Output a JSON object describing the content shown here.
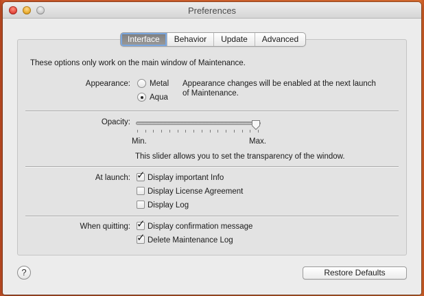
{
  "window": {
    "title": "Preferences"
  },
  "tabs": [
    {
      "label": "Interface",
      "selected": true
    },
    {
      "label": "Behavior",
      "selected": false
    },
    {
      "label": "Update",
      "selected": false
    },
    {
      "label": "Advanced",
      "selected": false
    }
  ],
  "intro_text": "These options only work on the main window of Maintenance.",
  "appearance": {
    "label": "Appearance:",
    "options": [
      {
        "label": "Metal",
        "selected": false
      },
      {
        "label": "Aqua",
        "selected": true
      }
    ],
    "note_line1": "Appearance changes will be enabled at the next launch",
    "note_line2": "of Maintenance."
  },
  "opacity": {
    "label": "Opacity:",
    "min_label": "Min.",
    "max_label": "Max.",
    "value_fraction": 1.0,
    "tick_count": 16,
    "description": "This slider allows you to set the transparency of the window."
  },
  "at_launch": {
    "label": "At launch:",
    "options": [
      {
        "label": "Display important Info",
        "checked": true
      },
      {
        "label": "Display License Agreement",
        "checked": false
      },
      {
        "label": "Display Log",
        "checked": false
      }
    ]
  },
  "when_quitting": {
    "label": "When quitting:",
    "options": [
      {
        "label": "Display confirmation message",
        "checked": true
      },
      {
        "label": "Delete Maintenance Log",
        "checked": true
      }
    ]
  },
  "footer": {
    "help_label": "?",
    "restore_label": "Restore Defaults"
  },
  "icons": {
    "help": "question-mark-icon",
    "checkmark": "checkmark-icon"
  }
}
